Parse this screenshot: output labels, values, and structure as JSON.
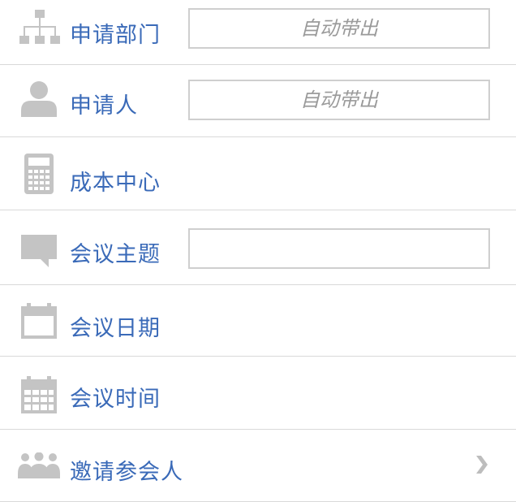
{
  "form": {
    "rows": [
      {
        "label": "申请部门",
        "icon": "org-chart-icon",
        "input_value": "",
        "input_placeholder": "自动带出"
      },
      {
        "label": "申请人",
        "icon": "person-icon",
        "input_value": "",
        "input_placeholder": "自动带出"
      },
      {
        "label": "成本中心",
        "icon": "calculator-icon"
      },
      {
        "label": "会议主题",
        "icon": "speech-bubble-icon",
        "input_value": "",
        "input_placeholder": ""
      },
      {
        "label": "会议日期",
        "icon": "calendar-icon"
      },
      {
        "label": "会议时间",
        "icon": "calendar-grid-icon"
      },
      {
        "label": "邀请参会人",
        "icon": "group-icon",
        "action_icon": "chevron-right-icon"
      }
    ]
  },
  "colors": {
    "label": "#3a6ab8",
    "icon": "#c4c4c4",
    "divider": "#d9d9d9",
    "field_border": "#cfcfcf",
    "placeholder": "#9a9a9a"
  }
}
